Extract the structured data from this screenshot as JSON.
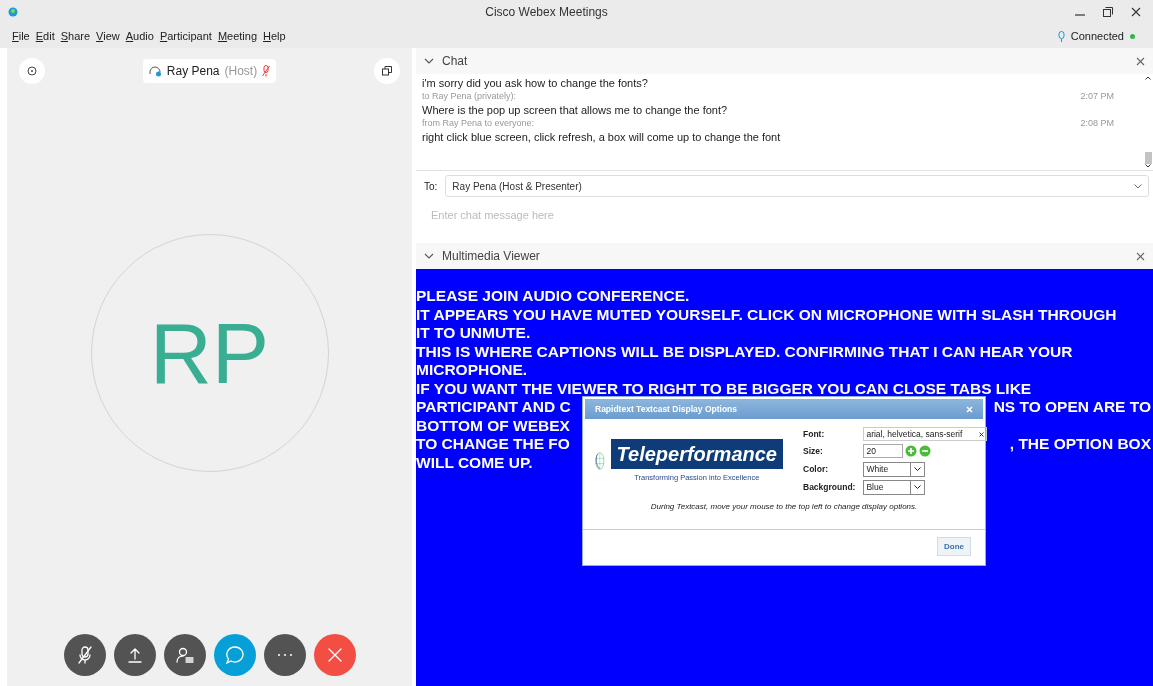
{
  "window": {
    "title": "Cisco Webex Meetings"
  },
  "menu": [
    "File",
    "Edit",
    "Share",
    "View",
    "Audio",
    "Participant",
    "Meeting",
    "Help"
  ],
  "status": {
    "label": "Connected",
    "color": "#2db84d"
  },
  "video": {
    "name": "Ray Pena",
    "role": "(Host)",
    "muted": true,
    "initials": "RP"
  },
  "controls": [
    {
      "kind": "mute"
    },
    {
      "kind": "share"
    },
    {
      "kind": "participants"
    },
    {
      "kind": "chat",
      "selected": true
    },
    {
      "kind": "more"
    },
    {
      "kind": "leave"
    }
  ],
  "chat": {
    "title": "Chat",
    "expanded": true,
    "messages": [
      {
        "kind": "text",
        "text": "i'm sorry did you ask how to change the fonts?"
      },
      {
        "kind": "meta",
        "text": "to Ray Pena (privately):",
        "time": "2:07 PM"
      },
      {
        "kind": "text",
        "text": "Where is the pop up screen that allows me to change the font?"
      },
      {
        "kind": "meta",
        "text": "from Ray Pena to everyone:",
        "time": "2:08 PM"
      },
      {
        "kind": "text",
        "text": "right click blue screen, click refresh, a box will come up to change the font"
      }
    ],
    "to_label": "To:",
    "to_value": "Ray Pena (Host & Presenter)",
    "placeholder": "Enter chat message here"
  },
  "viewer": {
    "title": "Multimedia Viewer",
    "expanded": true,
    "captions": [
      {
        "left": "PLEASE JOIN AUDIO CONFERENCE."
      },
      {
        "left": "IT APPEARS YOU HAVE MUTED YOURSELF. CLICK ON MICROPHONE WITH SLASH THROUGH"
      },
      {
        "left": "IT TO UNMUTE."
      },
      {
        "left": "THIS IS WHERE CAPTIONS WILL BE DISPLAYED. CONFIRMING THAT I CAN HEAR YOUR"
      },
      {
        "left": "MICROPHONE."
      },
      {
        "left": "IF YOU WANT THE VIEWER TO RIGHT TO BE BIGGER YOU CAN CLOSE TABS LIKE"
      },
      {
        "left": "PARTICIPANT AND C",
        "right": "NS TO OPEN ARE TO"
      },
      {
        "left": "BOTTOM OF WEBEX"
      },
      {
        "left": "TO CHANGE THE FO",
        "right": ", THE OPTION BOX"
      },
      {
        "left": "WILL COME UP."
      }
    ]
  },
  "dialog": {
    "title": "Rapidtext Textcast Display Options",
    "logo": {
      "name": "Teleperformance",
      "tagline": "Transforming Passion into Excellence"
    },
    "font_label": "Font:",
    "font_value": "arial, helvetica, sans-serif",
    "size_label": "Size:",
    "size_value": "20",
    "color_label": "Color:",
    "color_value": "White",
    "background_label": "Background:",
    "background_value": "Blue",
    "hint": "During Textcast, move your mouse to the top left to change display options.",
    "done": "Done"
  }
}
